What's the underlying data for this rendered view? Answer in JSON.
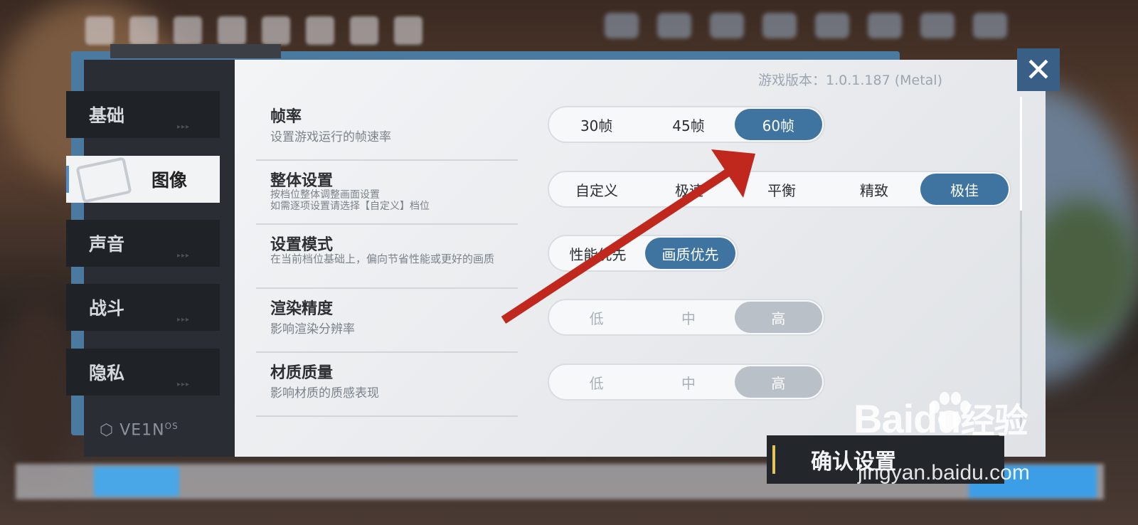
{
  "version_text": "游戏版本：1.0.1.187 (Metal)",
  "sidebar": {
    "items": [
      {
        "label": "基础",
        "active": false
      },
      {
        "label": "图像",
        "active": true
      },
      {
        "label": "声音",
        "active": false
      },
      {
        "label": "战斗",
        "active": false
      },
      {
        "label": "隐私",
        "active": false
      }
    ],
    "logo": "VE1N",
    "logo_sup": "OS"
  },
  "settings": [
    {
      "title": "帧率",
      "desc": "设置游戏运行的帧速率",
      "options": [
        "30帧",
        "45帧",
        "60帧"
      ],
      "selected": "60帧",
      "enabled": true
    },
    {
      "title": "整体设置",
      "desc_lines": [
        "按档位整体调整画面设置",
        "如需逐项设置请选择【自定义】档位"
      ],
      "options": [
        "自定义",
        "极速",
        "平衡",
        "精致",
        "极佳"
      ],
      "selected": "极佳",
      "enabled": true
    },
    {
      "title": "设置模式",
      "desc": "在当前档位基础上，偏向节省性能或更好的画质",
      "options": [
        "性能优先",
        "画质优先"
      ],
      "selected": "画质优先",
      "enabled": true
    },
    {
      "title": "渲染精度",
      "desc": "影响渲染分辨率",
      "options": [
        "低",
        "中",
        "高"
      ],
      "selected": "高",
      "enabled": false
    },
    {
      "title": "材质质量",
      "desc": "影响材质的质感表现",
      "options": [
        "低",
        "中",
        "高"
      ],
      "selected": "高",
      "enabled": false
    }
  ],
  "confirm_label": "确认设置",
  "close_label": "✕",
  "watermark": {
    "brand": "Bai",
    "brand2": "du",
    "cn": "经验",
    "url": "jingyan.baidu.com"
  },
  "colors": {
    "accent": "#3f74a0",
    "disabled_selected": "#b9c0c8",
    "annotation_arrow": "#c0281e",
    "confirm_bar": "#e5c55a"
  }
}
